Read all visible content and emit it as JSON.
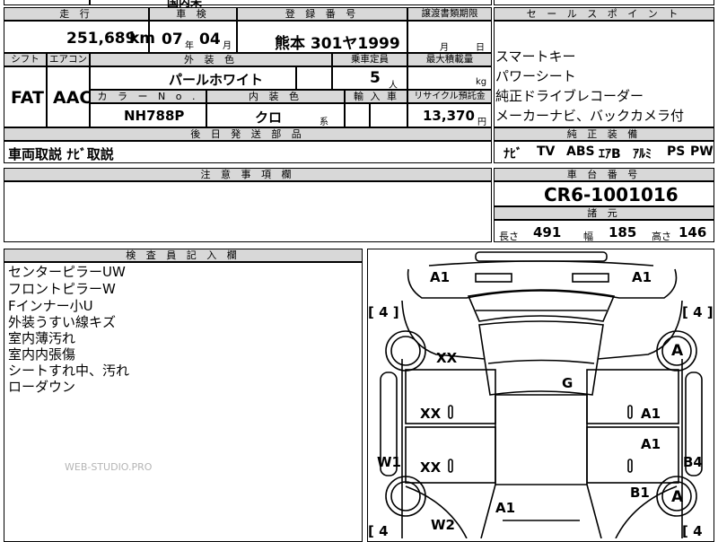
{
  "top_partial": "国内未",
  "vehicle": {
    "mileage_label": "走 行",
    "mileage_value": "251,689",
    "mileage_unit": "km",
    "inspection_label": "車 検",
    "inspection_year": "07",
    "inspection_year_unit": "年",
    "inspection_month": "04",
    "inspection_month_unit": "月",
    "registration_label": "登 録 番 号",
    "registration_value": "熊本 301ヤ1999",
    "transfer_label": "譲渡書類期限",
    "transfer_month_unit": "月",
    "transfer_day_unit": "日",
    "shift_label": "シフト",
    "shift_value": "FAT",
    "aircon_label": "エアコン",
    "aircon_value": "AAC",
    "exterior_color_label": "外 装 色",
    "exterior_color_value": "パールホワイト",
    "capacity_label": "乗車定員",
    "capacity_value": "5",
    "capacity_unit": "人",
    "max_load_label": "最大積載量",
    "max_load_unit": "kg",
    "color_no_label": "カ ラ ー N o .",
    "color_no_value": "NH788P",
    "interior_color_label": "内 装 色",
    "interior_color_value": "クロ",
    "interior_color_unit": "系",
    "import_label": "輸 入 車",
    "recycle_label": "リサイクル預託金",
    "recycle_value": "13,370",
    "recycle_unit": "円",
    "delivery_parts_label": "後 日 発 送 部 品",
    "delivery_parts_value": "車両取説 ﾅﾋﾞ取説",
    "notes_label": "注 意 事 項 欄"
  },
  "sales_points": {
    "label": "セ ー ル ス ポ イ ン ト",
    "items": [
      "スマートキー",
      "パワーシート",
      "純正ドライブレコーダー",
      "メーカーナビ、バックカメラ付"
    ]
  },
  "equipment": {
    "label": "純 正 装 備",
    "items": [
      "ﾅﾋﾞ",
      "TV",
      "ABS",
      "ｴｱB",
      "ｱﾙﾐ",
      "PS",
      "PW"
    ]
  },
  "chassis": {
    "label": "車 台 番 号",
    "value": "CR6-1001016"
  },
  "specs": {
    "label": "諸 元",
    "length_label": "長さ",
    "length_value": "491",
    "width_label": "幅",
    "width_value": "185",
    "height_label": "高さ",
    "height_value": "146"
  },
  "inspector": {
    "label": "検 査 員 記 入 欄",
    "lines": [
      "センターピラーUW",
      "フロントピラーW",
      "Fインナー小U",
      "外装うすい線キズ",
      "室内薄汚れ",
      "室内内張傷",
      "シートすれ中、汚れ",
      "ローダウン"
    ]
  },
  "watermark": "WEB-STUDIO.PRO",
  "diagram": {
    "marks": {
      "a1_front_left": "A1",
      "a1_front_right": "A1",
      "tire_fl": "[ 4 ]",
      "tire_fr": "[ 4 ]",
      "tire_rl": "[ 4",
      "tire_rr": "[ 4",
      "wheel_fr": "A",
      "wheel_rr": "A",
      "fender_left": "XX",
      "door_fl": "XX",
      "door_rl": "XX",
      "hood": "G",
      "door_fr": "A1",
      "door_rr": "A1",
      "sill_left": "W1",
      "sill_right": "B4",
      "quarter_right": "B1",
      "trunk": "A1",
      "quarter_left": "W2"
    }
  }
}
